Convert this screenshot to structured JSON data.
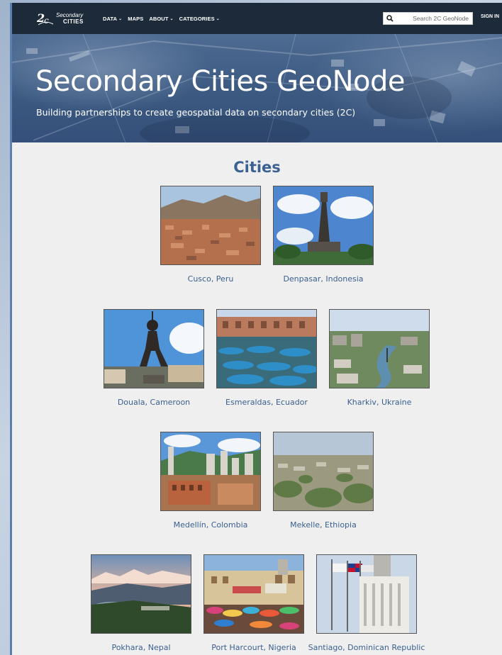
{
  "nav": {
    "logo_line1": "Secondary",
    "logo_line2": "CITIES",
    "items": [
      {
        "label": "DATA",
        "dropdown": true
      },
      {
        "label": "MAPS",
        "dropdown": false
      },
      {
        "label": "ABOUT",
        "dropdown": true
      },
      {
        "label": "CATEGORIES",
        "dropdown": true
      }
    ],
    "caret": "⌄",
    "search_placeholder": "Search 2C GeoNode",
    "signin": "SIGN IN"
  },
  "hero": {
    "title": "Secondary Cities GeoNode",
    "subtitle": "Building partnerships to create geospatial data on secondary cities (2C)"
  },
  "section": {
    "title": "Cities"
  },
  "cities": [
    {
      "caption": "Cusco, Peru"
    },
    {
      "caption": "Denpasar, Indonesia"
    },
    {
      "caption": "Douala, Cameroon"
    },
    {
      "caption": "Esmeraldas, Ecuador"
    },
    {
      "caption": "Kharkiv, Ukraine"
    },
    {
      "caption": "Medellín, Colombia"
    },
    {
      "caption": "Mekelle, Ethiopia"
    },
    {
      "caption": "Pokhara, Nepal"
    },
    {
      "caption": "Port Harcourt, Nigeria"
    },
    {
      "caption": "Santiago, Dominican Republic"
    }
  ],
  "colors": {
    "nav_bg": "#1d2a3a",
    "hero_bg": "#3c5a82",
    "accent_text": "#3a6190",
    "page_bg": "#efefef"
  }
}
